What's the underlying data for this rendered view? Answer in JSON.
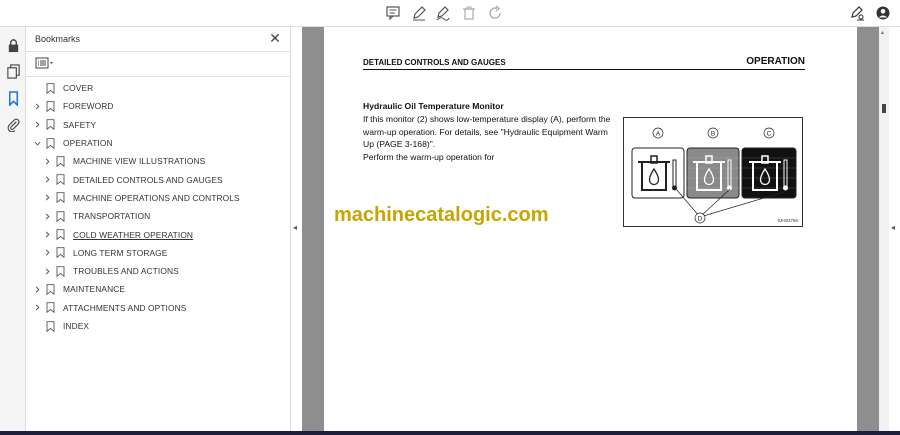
{
  "toolbar": {
    "tools": [
      "comment-icon",
      "highlight-pen-icon",
      "draw-icon",
      "delete-icon",
      "rotate-icon"
    ],
    "right_tools": [
      "sign-icon",
      "account-icon"
    ]
  },
  "rail": {
    "items": [
      "lock-icon",
      "pages-icon",
      "bookmark-icon",
      "attachment-icon"
    ]
  },
  "bookmarks_panel": {
    "title": "Bookmarks",
    "close": "✕",
    "items": [
      {
        "label": "COVER",
        "level": 0,
        "chevron": "none"
      },
      {
        "label": "FOREWORD",
        "level": 0,
        "chevron": "right"
      },
      {
        "label": "SAFETY",
        "level": 0,
        "chevron": "right"
      },
      {
        "label": "OPERATION",
        "level": 0,
        "chevron": "down"
      },
      {
        "label": "MACHINE VIEW ILLUSTRATIONS",
        "level": 1,
        "chevron": "right"
      },
      {
        "label": "DETAILED CONTROLS AND GAUGES",
        "level": 1,
        "chevron": "right"
      },
      {
        "label": "MACHINE OPERATIONS AND CONTROLS",
        "level": 1,
        "chevron": "right"
      },
      {
        "label": "TRANSPORTATION",
        "level": 1,
        "chevron": "right"
      },
      {
        "label": "COLD WEATHER OPERATION",
        "level": 1,
        "chevron": "right",
        "underline": true
      },
      {
        "label": "LONG TERM STORAGE",
        "level": 1,
        "chevron": "right"
      },
      {
        "label": "TROUBLES AND ACTIONS",
        "level": 1,
        "chevron": "right"
      },
      {
        "label": "MAINTENANCE",
        "level": 0,
        "chevron": "right"
      },
      {
        "label": "ATTACHMENTS AND OPTIONS",
        "level": 0,
        "chevron": "right"
      },
      {
        "label": "INDEX",
        "level": 0,
        "chevron": "none"
      }
    ]
  },
  "document": {
    "header_left": "DETAILED CONTROLS AND GAUGES",
    "header_right": "OPERATION",
    "section_title": "Hydraulic Oil Temperature Monitor",
    "body_lines": [
      "If this monitor (2) shows low-temperature display (A), perform the",
      "warm-up operation. For details, see \"Hydraulic Equipment Warm",
      "Up (PAGE 3-168)\".",
      "Perform the warm-up operation for"
    ],
    "figure": {
      "labels": [
        "A",
        "B",
        "C",
        "D"
      ],
      "code": "9JH03766"
    },
    "watermark": "machinecatalogic.com"
  },
  "colors": {
    "watermark": "#c9a400",
    "doc_background": "#8e8e8e",
    "accent": "#1a73e8"
  }
}
